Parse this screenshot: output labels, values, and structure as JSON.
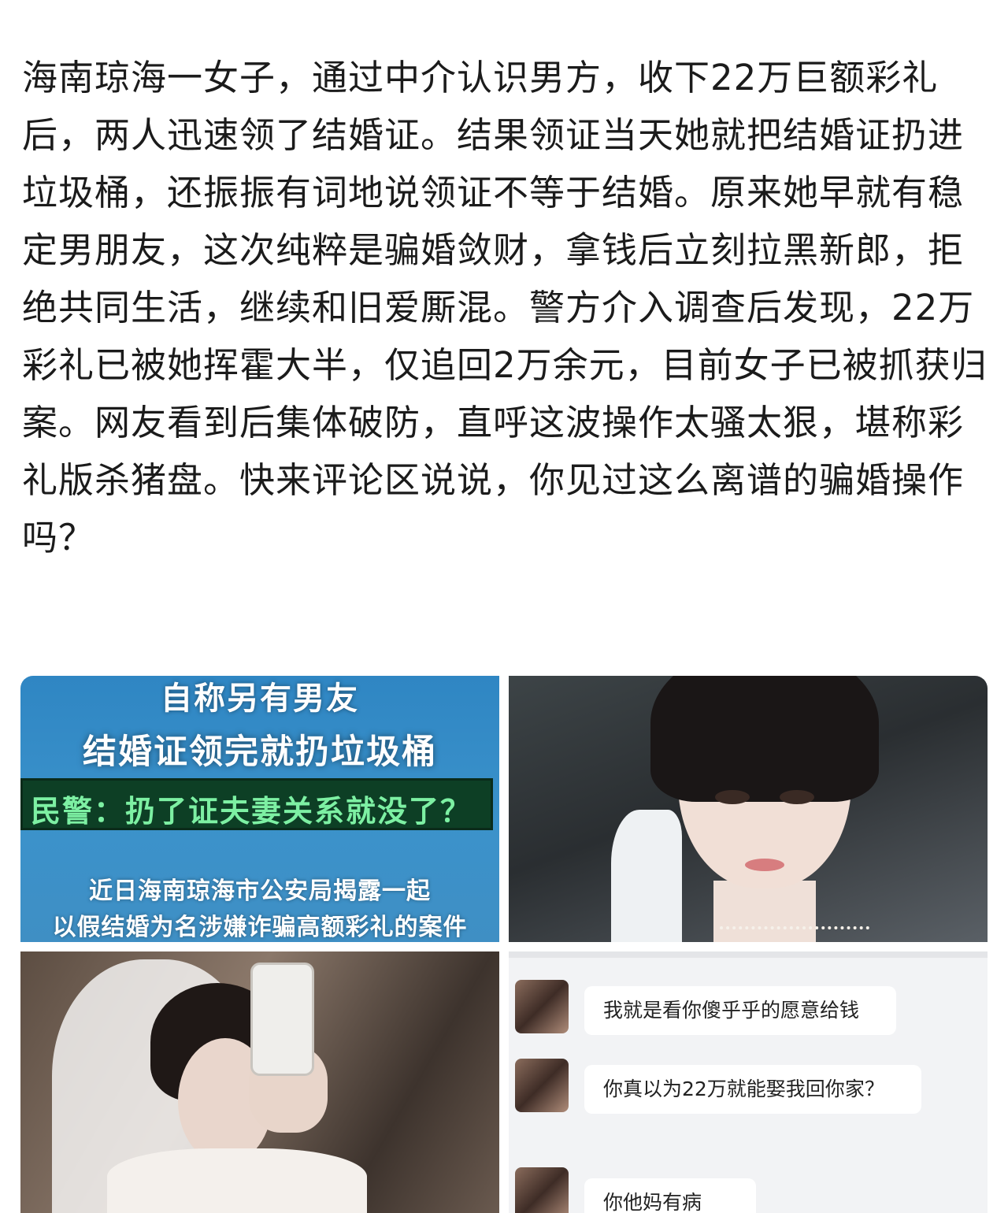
{
  "post": {
    "text": "海南琼海一女子，通过中介认识男方，收下22万巨额彩礼后，两人迅速领了结婚证。结果领证当天她就把结婚证扔进垃圾桶，还振振有词地说领证不等于结婚。原来她早就有稳定男朋友，这次纯粹是骗婚敛财，拿钱后立刻拉黑新郎，拒绝共同生活，继续和旧爱厮混。警方介入调查后发现，22万彩礼已被她挥霍大半，仅追回2万余元，目前女子已被抓获归案。网友看到后集体破防，直呼这波操作太骚太狠，堪称彩礼版杀猪盘。快来评论区说说，你见过这么离谱的骗婚操作吗？"
  },
  "news_image": {
    "title_partial": "自称另有男友",
    "title": "结婚证领完就扔垃圾桶",
    "band": "民警：扔了证夫妻关系就没了？",
    "body_line1": "近日海南琼海市公安局揭露一起",
    "body_line2": "以假结婚为名涉嫌诈骗高额彩礼的案件"
  },
  "chat": {
    "messages": [
      {
        "text": "我就是看你傻乎乎的愿意给钱"
      },
      {
        "text": "你真以为22万就能娶我回你家？"
      },
      {
        "text": "你他妈有病吧？"
      }
    ]
  },
  "colors": {
    "news_bg": "#3b92cb",
    "band_bg": "#0d3f25",
    "band_text": "#7df0a3",
    "chat_bg": "#f2f3f5"
  }
}
